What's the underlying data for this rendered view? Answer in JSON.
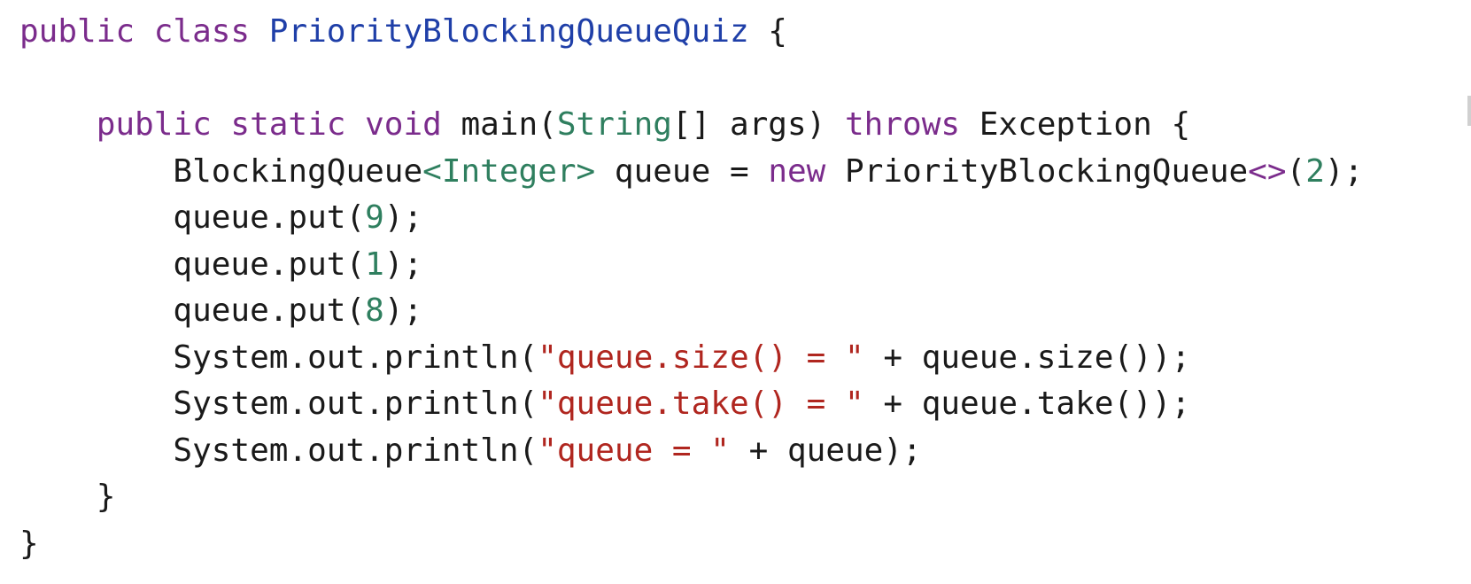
{
  "editor": {
    "language": "java",
    "colors": {
      "background": "#ffffff",
      "keyword": "#7b2c8c",
      "type": "#2f7f5f",
      "number": "#2f7f5f",
      "string": "#b0261f",
      "class_name": "#1f3fa8",
      "plain": "#1a1a1a"
    },
    "lines": [
      [
        {
          "text": "public class ",
          "kind": "kw"
        },
        {
          "text": "PriorityBlockingQueueQuiz",
          "kind": "cls"
        },
        {
          "text": " {",
          "kind": "plain"
        }
      ],
      [],
      [
        {
          "text": "    public static void ",
          "kind": "kw"
        },
        {
          "text": "main(",
          "kind": "plain"
        },
        {
          "text": "String",
          "kind": "type"
        },
        {
          "text": "[] args) ",
          "kind": "plain"
        },
        {
          "text": "throws ",
          "kind": "kw"
        },
        {
          "text": "Exception {",
          "kind": "plain"
        }
      ],
      [
        {
          "text": "        BlockingQueue",
          "kind": "plain"
        },
        {
          "text": "<Integer>",
          "kind": "type"
        },
        {
          "text": " queue = ",
          "kind": "plain"
        },
        {
          "text": "new ",
          "kind": "kw"
        },
        {
          "text": "PriorityBlockingQueue",
          "kind": "plain"
        },
        {
          "text": "<>",
          "kind": "kw"
        },
        {
          "text": "(",
          "kind": "plain"
        },
        {
          "text": "2",
          "kind": "num"
        },
        {
          "text": ");",
          "kind": "plain"
        }
      ],
      [
        {
          "text": "        queue.put(",
          "kind": "plain"
        },
        {
          "text": "9",
          "kind": "num"
        },
        {
          "text": ");",
          "kind": "plain"
        }
      ],
      [
        {
          "text": "        queue.put(",
          "kind": "plain"
        },
        {
          "text": "1",
          "kind": "num"
        },
        {
          "text": ");",
          "kind": "plain"
        }
      ],
      [
        {
          "text": "        queue.put(",
          "kind": "plain"
        },
        {
          "text": "8",
          "kind": "num"
        },
        {
          "text": ");",
          "kind": "plain"
        }
      ],
      [
        {
          "text": "        System.out.println(",
          "kind": "plain"
        },
        {
          "text": "\"queue.size() = \"",
          "kind": "str"
        },
        {
          "text": " + queue.size());",
          "kind": "plain"
        }
      ],
      [
        {
          "text": "        System.out.println(",
          "kind": "plain"
        },
        {
          "text": "\"queue.take() = \"",
          "kind": "str"
        },
        {
          "text": " + queue.take());",
          "kind": "plain"
        }
      ],
      [
        {
          "text": "        System.out.println(",
          "kind": "plain"
        },
        {
          "text": "\"queue = \"",
          "kind": "str"
        },
        {
          "text": " + queue);",
          "kind": "plain"
        }
      ],
      [
        {
          "text": "    }",
          "kind": "plain"
        }
      ],
      [
        {
          "text": "}",
          "kind": "plain"
        }
      ]
    ]
  }
}
